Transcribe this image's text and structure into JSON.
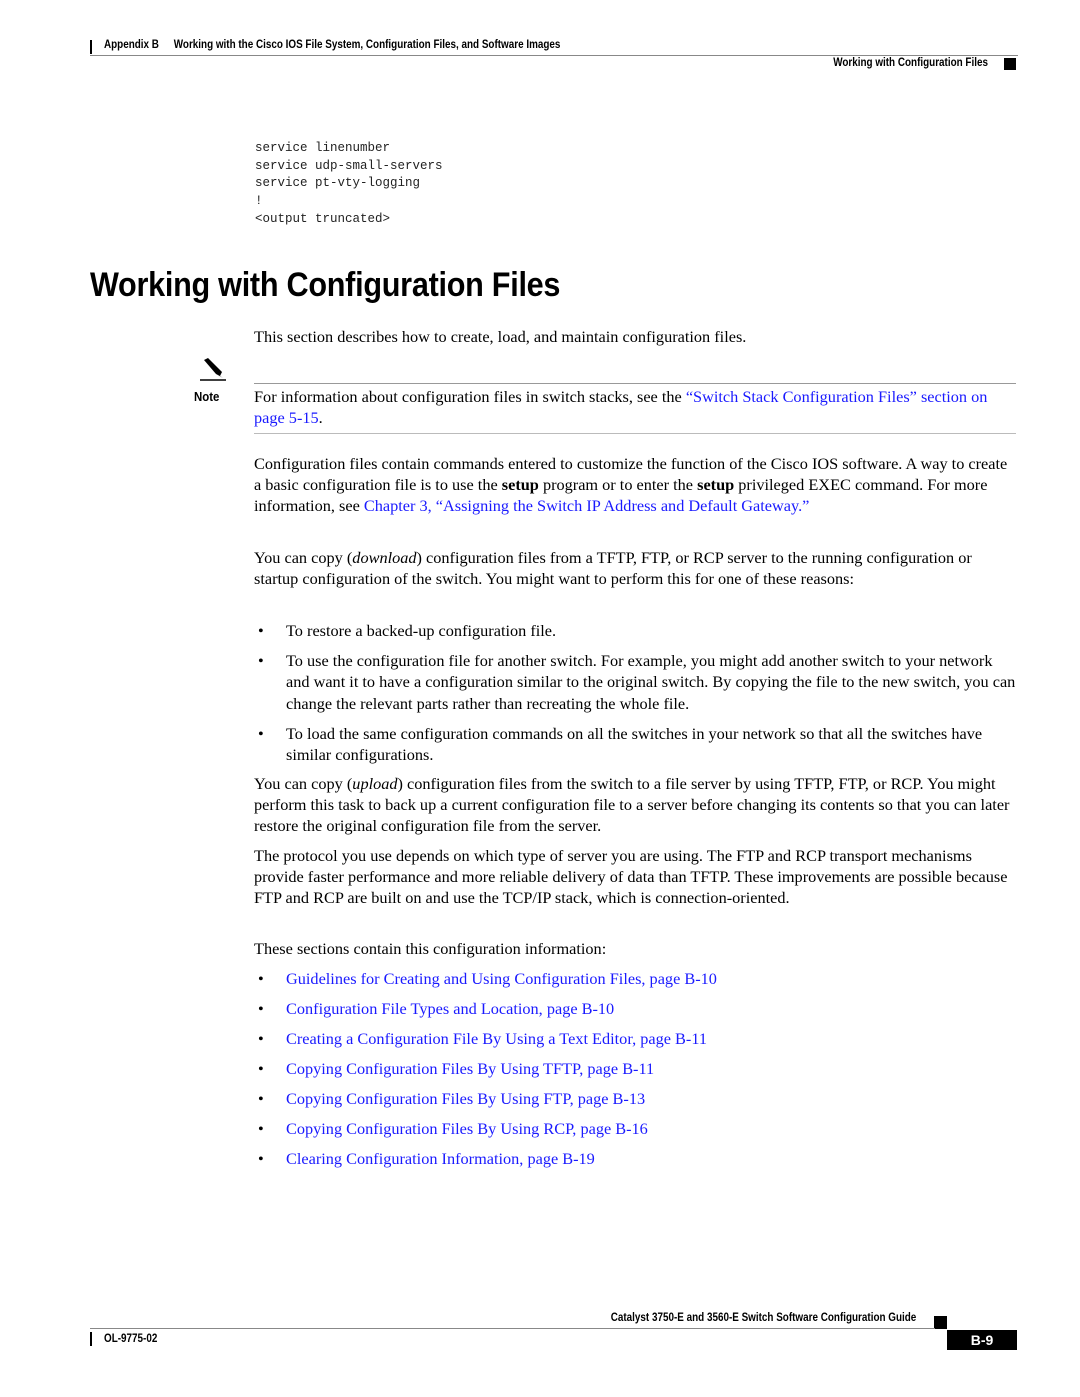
{
  "header": {
    "appendix": "Appendix B",
    "chapter_title": "Working with the Cisco IOS File System, Configuration Files, and Software Images",
    "section_title": "Working with Configuration Files"
  },
  "code_block": {
    "lines": [
      "service linenumber",
      "service udp-small-servers",
      "service pt-vty-logging",
      "!",
      "<output truncated>"
    ]
  },
  "main": {
    "title": "Working with Configuration Files",
    "intro": "This section describes how to create, load, and maintain configuration files.",
    "note": {
      "label": "Note",
      "text_before": "For information about configuration files in switch stacks, see the ",
      "link": "“Switch Stack Configuration Files” section on page 5-15",
      "text_after": "."
    },
    "para1": {
      "t1": "Configuration files contain commands entered to customize the function of the Cisco IOS software. A way to create a basic configuration file is to use the ",
      "b1": "setup",
      "t2": " program or to enter the ",
      "b2": "setup",
      "t3": " privileged EXEC command. For more information, see ",
      "link": "Chapter 3, “Assigning the Switch IP Address and Default Gateway.”"
    },
    "para2": {
      "t1": "You can copy (",
      "i1": "download",
      "t2": ") configuration files from a TFTP, FTP, or RCP server to the running configuration or startup configuration of the switch. You might want to perform this for one of these reasons:"
    },
    "reasons": [
      "To restore a backed-up configuration file.",
      "To use the configuration file for another switch. For example, you might add another switch to your network and want it to have a configuration similar to the original switch. By copying the file to the new switch, you can change the relevant parts rather than recreating the whole file.",
      "To load the same configuration commands on all the switches in your network so that all the switches have similar configurations."
    ],
    "para3": {
      "t1": "You can copy (",
      "i1": "upload",
      "t2": ") configuration files from the switch to a file server by using TFTP, FTP, or RCP. You might perform this task to back up a current configuration file to a server before changing its contents so that you can later restore the original configuration file from the server."
    },
    "para4": "The protocol you use depends on which type of server you are using. The FTP and RCP transport mechanisms provide faster performance and more reliable delivery of data than TFTP. These improvements are possible because FTP and RCP are built on and use the TCP/IP stack, which is connection-oriented.",
    "para5": "These sections contain this configuration information:",
    "toc_links": [
      "Guidelines for Creating and Using Configuration Files, page B-10",
      "Configuration File Types and Location, page B-10",
      "Creating a Configuration File By Using a Text Editor, page B-11",
      "Copying Configuration Files By Using TFTP, page B-11",
      "Copying Configuration Files By Using FTP, page B-13",
      "Copying Configuration Files By Using RCP, page B-16",
      "Clearing Configuration Information, page B-19"
    ],
    "bullet_char": "•",
    "link_color": "#1a1aff"
  },
  "footer": {
    "guide_title": "Catalyst 3750-E and 3560-E Switch Software Configuration Guide",
    "doc_number": "OL-9775-02",
    "page_number": "B-9"
  }
}
